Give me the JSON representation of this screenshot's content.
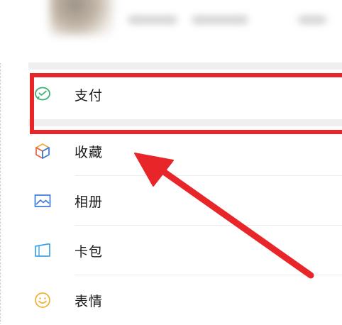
{
  "menu": {
    "items": [
      {
        "label": "支付",
        "icon": "wechat-pay-icon",
        "color": "#3cb371"
      },
      {
        "label": "收藏",
        "icon": "cube-icon",
        "color": "#f4a93b"
      },
      {
        "label": "相册",
        "icon": "photo-album-icon",
        "color": "#3a79d6"
      },
      {
        "label": "卡包",
        "icon": "card-wallet-icon",
        "color": "#3aa0e8"
      },
      {
        "label": "表情",
        "icon": "smiley-icon",
        "color": "#f0b030"
      }
    ]
  },
  "annotation": {
    "highlight_color": "#e8262a"
  }
}
